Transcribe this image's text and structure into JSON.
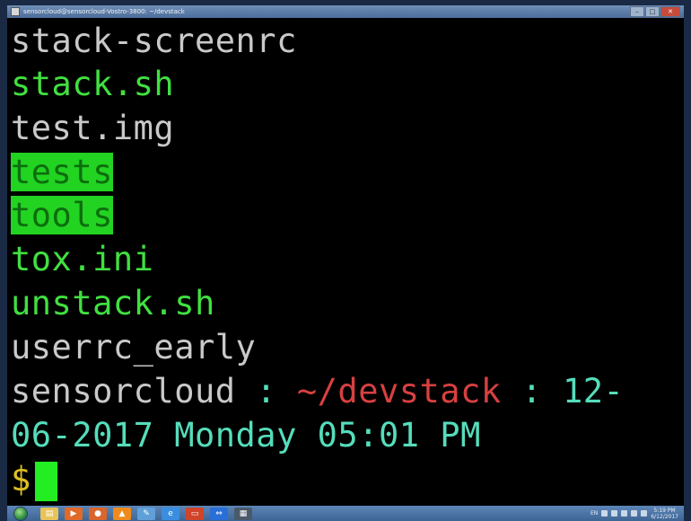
{
  "window": {
    "title": "sensorcloud@sensorcloud-Vostro-3800: ~/devstack",
    "minimize_label": "–",
    "maximize_label": "□",
    "close_label": "✕"
  },
  "terminal": {
    "lines": [
      {
        "text": "stack-screenrc",
        "color": "#c9c9c9"
      },
      {
        "text": "stack.sh",
        "color": "#40e040"
      },
      {
        "text": "test.img",
        "color": "#c9c9c9"
      },
      {
        "text": "tests",
        "highlight": true
      },
      {
        "text": "tools",
        "highlight": true
      },
      {
        "text": "tox.ini",
        "color": "#40e040"
      },
      {
        "text": "unstack.sh",
        "color": "#40e040"
      },
      {
        "text": "userrc_early",
        "color": "#c9c9c9"
      }
    ],
    "prompt": {
      "user": "sensorcloud",
      "sep1": " : ",
      "path": "~/devstack",
      "sep2": " : ",
      "date_part1": "12-",
      "date_part2": "06-2017 Monday 05:01 PM",
      "symbol": "$"
    }
  },
  "taskbar": {
    "icons": [
      {
        "name": "file-explorer-icon",
        "color": "#e8c35a",
        "glyph": "▤"
      },
      {
        "name": "media-player-icon",
        "color": "#e06a2a",
        "glyph": "▶"
      },
      {
        "name": "firefox-icon",
        "color": "#d9662c",
        "glyph": "●"
      },
      {
        "name": "vlc-icon",
        "color": "#f08a1c",
        "glyph": "▲"
      },
      {
        "name": "paint-icon",
        "color": "#5fa0d8",
        "glyph": "✎"
      },
      {
        "name": "internet-explorer-icon",
        "color": "#3a8ee0",
        "glyph": "e"
      },
      {
        "name": "presentation-icon",
        "color": "#d0442a",
        "glyph": "▭"
      },
      {
        "name": "teamviewer-icon",
        "color": "#2a6fd8",
        "glyph": "⇔"
      },
      {
        "name": "terminal-app-icon",
        "color": "#4a5a6a",
        "glyph": "▦"
      }
    ],
    "tray": {
      "language": "EN",
      "time": "5:19 PM",
      "date": "6/12/2017"
    }
  }
}
